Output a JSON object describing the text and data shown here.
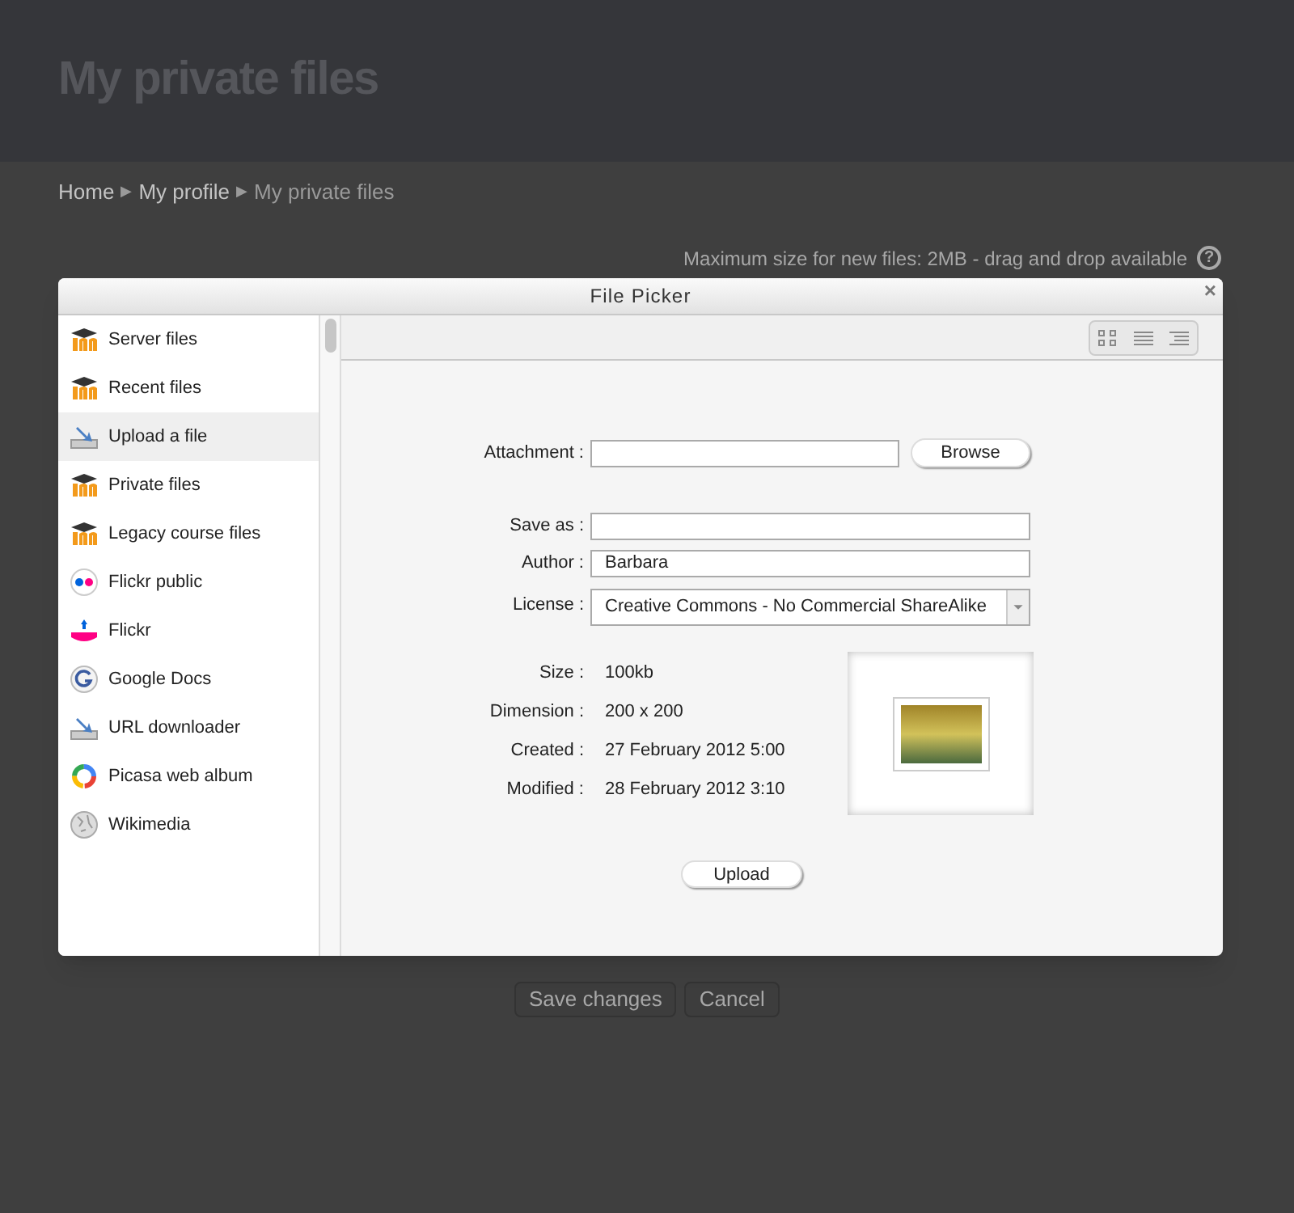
{
  "page": {
    "title": "My private files",
    "breadcrumb": [
      {
        "label": "Home",
        "current": false
      },
      {
        "label": "My profile",
        "current": false
      },
      {
        "label": "My private files",
        "current": true
      }
    ],
    "breadcrumb_separator": "▶",
    "max_size_note": "Maximum size for new files: 2MB - drag and drop available",
    "help": "?",
    "buttons": [
      "Save changes",
      "Cancel"
    ]
  },
  "dialog": {
    "title": "File Picker",
    "close": "×",
    "sidebar": [
      {
        "label": "Server files",
        "kind": "moodle",
        "selected": false
      },
      {
        "label": "Recent files",
        "kind": "moodle",
        "selected": false
      },
      {
        "label": "Upload a file",
        "kind": "upload",
        "selected": true
      },
      {
        "label": "Private files",
        "kind": "moodle",
        "selected": false
      },
      {
        "label": "Legacy course files",
        "kind": "moodle",
        "selected": false
      },
      {
        "label": "Flickr public",
        "kind": "flickr-public",
        "selected": false
      },
      {
        "label": "Flickr",
        "kind": "flickr",
        "selected": false
      },
      {
        "label": "Google Docs",
        "kind": "google",
        "selected": false
      },
      {
        "label": "URL downloader",
        "kind": "upload",
        "selected": false
      },
      {
        "label": "Picasa web album",
        "kind": "picasa",
        "selected": false
      },
      {
        "label": "Wikimedia",
        "kind": "wikimedia",
        "selected": false
      }
    ],
    "view_modes": [
      {
        "kind": "icons",
        "selected": false
      },
      {
        "kind": "list",
        "selected": false
      },
      {
        "kind": "tree",
        "selected": false
      }
    ],
    "attachment": {
      "label": "Attachment :",
      "button": "Browse"
    },
    "fields": [
      {
        "label": "Save as :"
      },
      {
        "label": "Author :",
        "value": "Barbara"
      }
    ],
    "license": {
      "label": "License :",
      "value": "Creative Commons - No Commercial ShareAlike"
    },
    "details": [
      {
        "label": "Size :",
        "value": "100kb"
      },
      {
        "label": "Dimension :",
        "value": "200 x 200"
      },
      {
        "label": "Created :",
        "value": "27 February 2012 5:00"
      },
      {
        "label": "Modified :",
        "value": "28 February 2012 3:10"
      }
    ],
    "upload_button": "Upload"
  }
}
